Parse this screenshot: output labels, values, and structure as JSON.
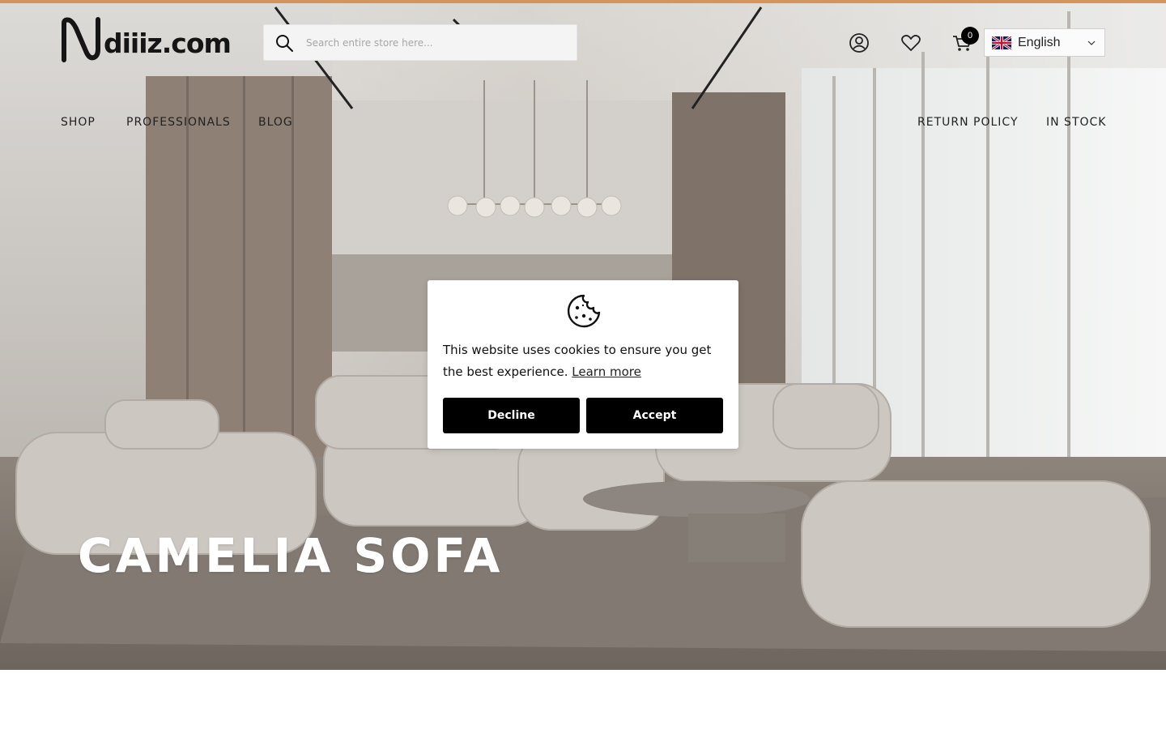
{
  "brand": {
    "logo_text": "diiiz.com",
    "accent_color": "#d4945a"
  },
  "search": {
    "placeholder": "Search entire store here..."
  },
  "header": {
    "icons": [
      "account-icon",
      "wishlist-heart-icon",
      "cart-icon"
    ],
    "cart_count": "0",
    "language": {
      "selected": "English",
      "flag": "uk-flag-icon"
    }
  },
  "nav": {
    "left": [
      "SHOP",
      "PROFESSIONALS",
      "BLOG"
    ],
    "right": [
      "RETURN POLICY",
      "IN STOCK"
    ]
  },
  "hero": {
    "title": "CAMELIA SOFA"
  },
  "cookie_banner": {
    "icon": "cookie-icon",
    "message": "This website uses cookies to ensure you get the best experience.",
    "learn_more": "Learn more",
    "decline": "Decline",
    "accept": "Accept"
  }
}
